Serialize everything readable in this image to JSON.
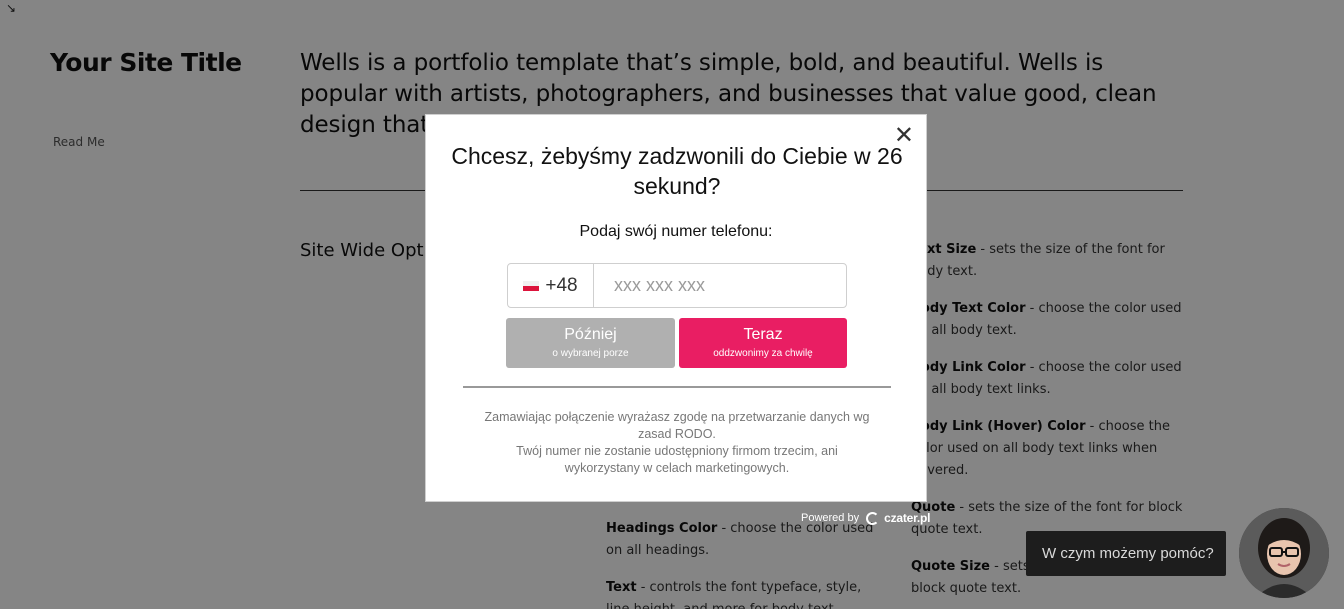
{
  "site": {
    "title": "Your Site Title",
    "read_me": "Read Me",
    "intro": "Wells is a portfolio template that’s simple, bold, and beautiful. Wells is popular with artists, photographers, and businesses that value good, clean design that’s easy to update.",
    "section_title": "Site Wide Options",
    "middle_column": [
      {
        "term": "Headings Color",
        "desc": " - choose the color used on all headings."
      },
      {
        "term": "Text",
        "desc": " - controls the font typeface, style, line height, and more for body text."
      }
    ],
    "right_column": [
      {
        "term": "Text Size",
        "desc": " - sets the size of the font for body text."
      },
      {
        "term": "Body Text Color",
        "desc": " - choose the color used on all body text."
      },
      {
        "term": "Body Link Color",
        "desc": " - choose the color used on all body text links."
      },
      {
        "term": "Body Link (Hover) Color",
        "desc": " - choose the color used on all body text links when hovered."
      },
      {
        "term": "Quote",
        "desc": " - sets the size of the font for block quote text."
      },
      {
        "term": "Quote Size",
        "desc": " - sets the size of the font for block quote text."
      }
    ]
  },
  "modal": {
    "title": "Chcesz, żebyśmy zadzwonili do Ciebie w 26 sekund?",
    "subtitle": "Podaj swój numer telefonu:",
    "country_code": "+48",
    "phone_placeholder": "xxx xxx xxx",
    "later_label": "Później",
    "later_sub": "o wybranej porze",
    "now_label": "Teraz",
    "now_sub": "oddzwonimy za chwilę",
    "consent_line1": "Zamawiając połączenie wyrażasz zgodę na przetwarzanie danych wg zasad RODO.",
    "consent_line2": "Twój numer nie zostanie udostępniony firmom trzecim, ani wykorzystany w celach marketingowych.",
    "close": "✕"
  },
  "powered": {
    "label": "Powered by",
    "brand": "czater.pl"
  },
  "chat": {
    "bubble_text": "W czym możemy pomóc?"
  },
  "colors": {
    "accent": "#e91e63",
    "later_button": "#b0b0b0",
    "overlay": "rgba(0,0,0,0.48)"
  },
  "icons": {
    "corner": "arrow-icon",
    "close": "close-icon",
    "flag": "poland-flag-icon",
    "avatar": "agent-avatar"
  }
}
